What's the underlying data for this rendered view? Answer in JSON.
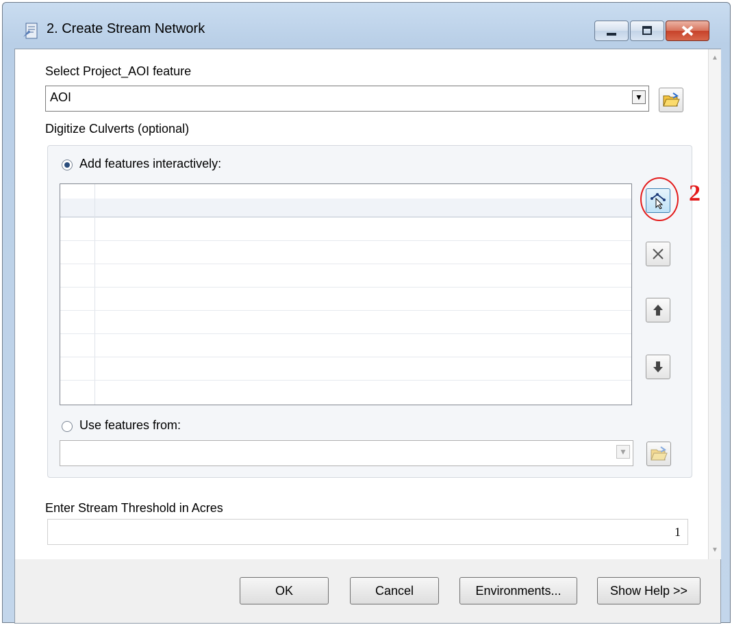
{
  "window": {
    "title": "2. Create Stream Network",
    "app_icon": "toolbox-script-icon",
    "caption_icons": [
      "minimize-icon",
      "maximize-icon",
      "close-icon"
    ]
  },
  "form": {
    "project_aoi_label": "Select Project_AOI feature",
    "project_aoi_value": "AOI",
    "culverts_label": "Digitize Culverts (optional)",
    "add_interactive_label": "Add features interactively:",
    "add_interactive_selected": true,
    "use_features_label": "Use features from:",
    "use_features_selected": false,
    "use_features_value": "",
    "threshold_label": "Enter Stream Threshold in Acres",
    "threshold_value": "1"
  },
  "buttons": {
    "ok": "OK",
    "cancel": "Cancel",
    "environments": "Environments...",
    "show_help": "Show Help >>"
  },
  "annotation": {
    "number": "2",
    "color": "#e31a1a"
  }
}
